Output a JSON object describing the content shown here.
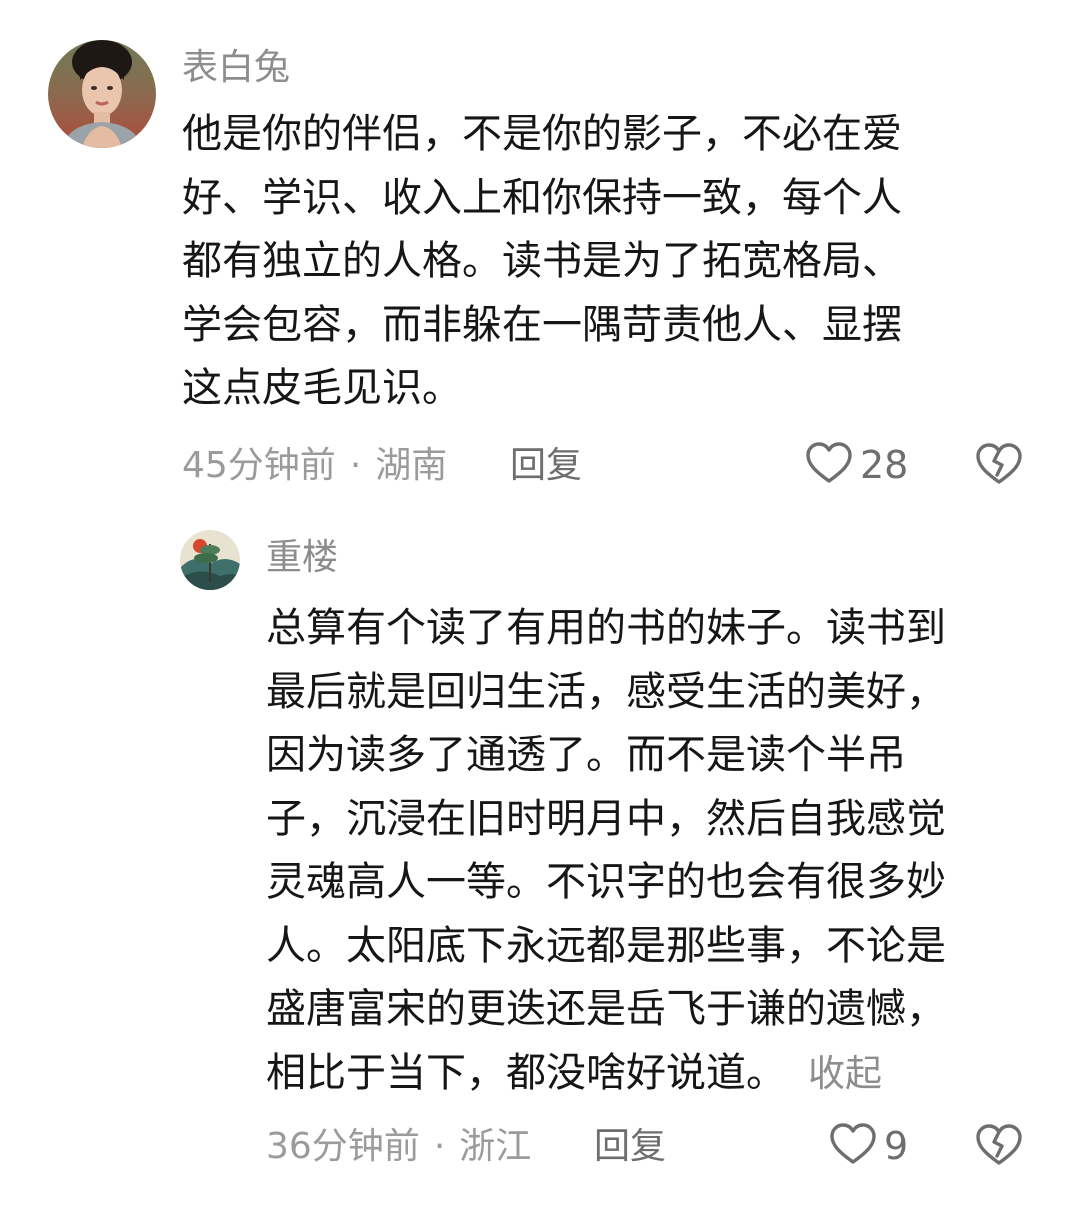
{
  "comments": [
    {
      "username": "表白兔",
      "lines": [
        "他是你的伴侣，不是你的影子，不必在爱",
        "好、学识、收入上和你保持一致，每个人",
        "都有独立的人格。读书是为了拓宽格局、",
        "学会包容，而非躲在一隅苛责他人、显摆",
        "这点皮毛见识。"
      ],
      "time": "45分钟前",
      "separator": "·",
      "location": "湖南",
      "reply_label": "回复",
      "likes": "28"
    }
  ],
  "replies": [
    {
      "username": "重楼",
      "lines": [
        "总算有个读了有用的书的妹子。读书到",
        "最后就是回归生活，感受生活的美好，",
        "因为读多了通透了。而不是读个半吊",
        "子，沉浸在旧时明月中，然后自我感觉",
        "灵魂高人一等。不识字的也会有很多妙",
        "人。太阳底下永远都是那些事，不论是",
        "盛唐富宋的更迭还是岳飞于谦的遗憾，",
        "相比于当下，都没啥好说道。"
      ],
      "collapse_label": "收起",
      "time": "36分钟前",
      "separator": "·",
      "location": "浙江",
      "reply_label": "回复",
      "likes": "9"
    }
  ],
  "icons": {
    "like": "heart-outline-icon",
    "dislike": "broken-heart-icon"
  },
  "colors": {
    "text": "#161616",
    "secondary": "#9b9b9b",
    "action": "#6e6e6e"
  }
}
